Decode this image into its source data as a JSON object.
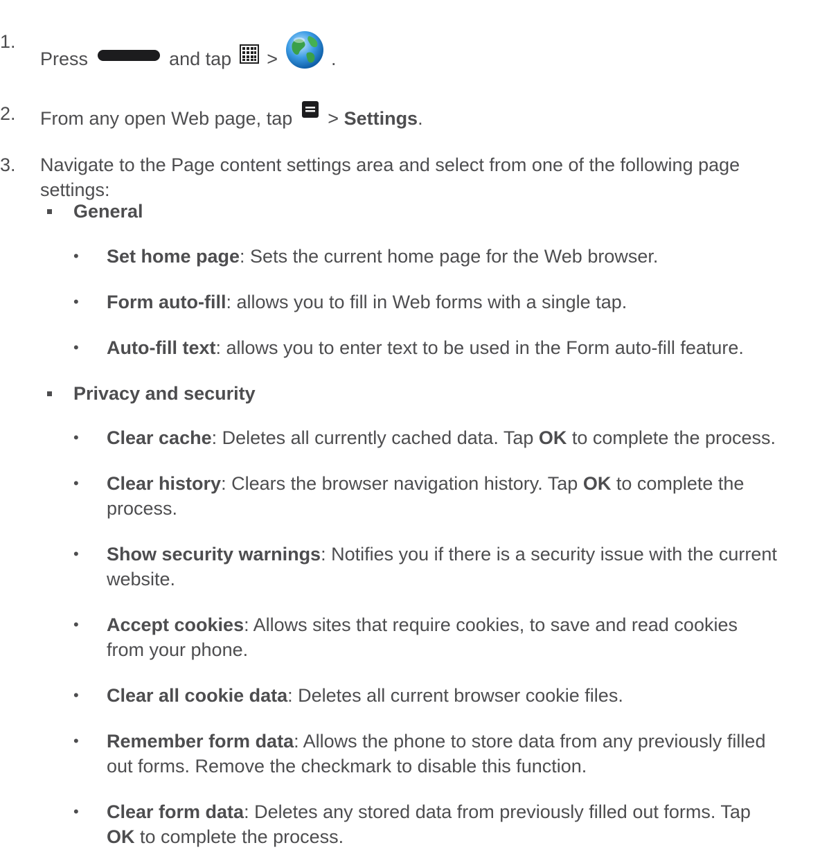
{
  "steps": [
    {
      "num": "1.",
      "text_press": "Press",
      "text_and_tap": "and tap",
      "text_gt": ">",
      "text_end": ".",
      "icons": [
        "home-key-icon",
        "apps-grid-icon",
        "internet-globe-icon"
      ]
    },
    {
      "num": "2.",
      "text_before": "From any open Web page, tap",
      "text_gt": ">",
      "bold": "Settings",
      "text_end": ".",
      "icons": [
        "menu-key-icon"
      ]
    },
    {
      "num": "3.",
      "text": "Navigate to the Page content settings area and select from one of the following page",
      "text_line2": "settings:"
    }
  ],
  "sections": [
    {
      "title": "General",
      "items": [
        {
          "bold": "Set home page",
          "text": ": Sets the current home page for the Web browser."
        },
        {
          "bold": "Form auto-fill",
          "text": ": allows you to fill in Web forms with a single tap."
        },
        {
          "bold": "Auto-fill text",
          "text": ": allows you to enter text to be used in the Form auto-fill feature."
        }
      ]
    },
    {
      "title": "Privacy and security",
      "items": [
        {
          "bold": "Clear cache",
          "text": ": Deletes all currently cached data. Tap ",
          "bold2": "OK",
          "text2": " to complete the process."
        },
        {
          "bold": "Clear history",
          "text": ": Clears the browser navigation history. Tap ",
          "bold2": "OK",
          "text2": " to complete the",
          "line2": "process."
        },
        {
          "bold": "Show security warnings",
          "text": ": Notifies you if there is a security issue with the current",
          "line2": "website."
        },
        {
          "bold": "Accept cookies",
          "text": ": Allows sites that require cookies, to save and read cookies",
          "line2": "from your phone."
        },
        {
          "bold": "Clear all cookie data",
          "text": ": Deletes all current browser cookie files."
        },
        {
          "bold": "Remember form data",
          "text": ": Allows the phone to store data from any previously filled",
          "line2": "out forms. Remove the checkmark to disable this function."
        },
        {
          "bold": "Clear form data",
          "text": ": Deletes any stored data from previously filled out forms. Tap",
          "line2_bold": "OK",
          "line2": " to complete the process."
        }
      ]
    }
  ],
  "bullet_char": "•"
}
